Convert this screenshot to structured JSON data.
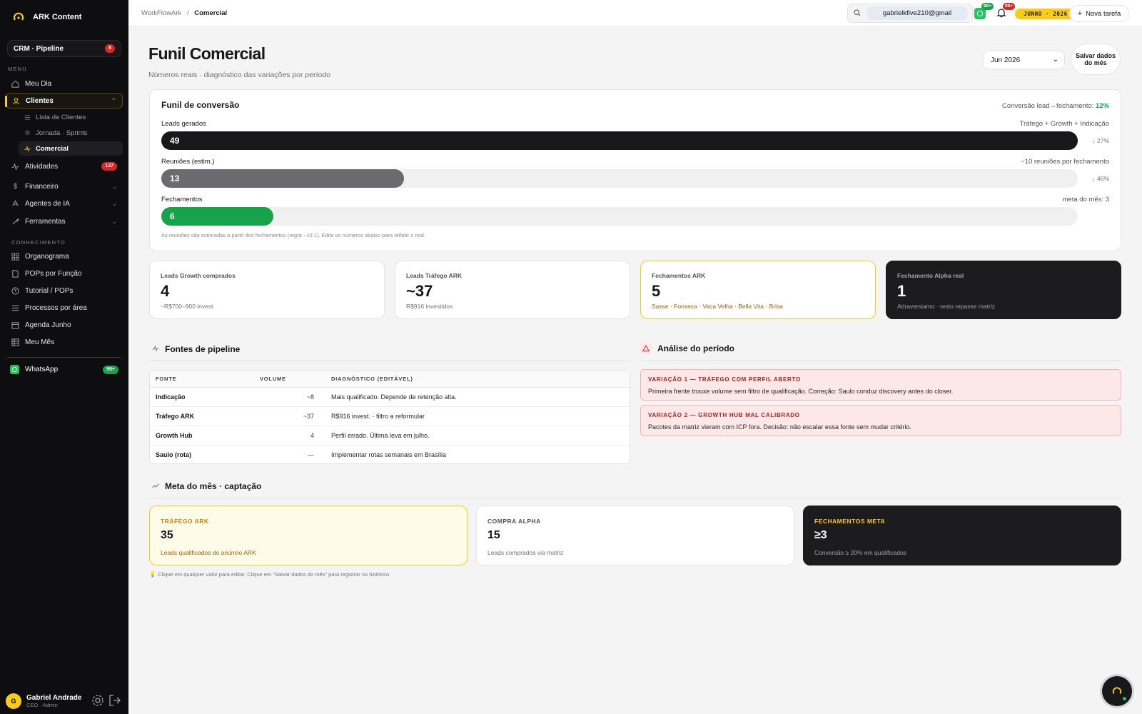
{
  "sidebar": {
    "brand": "ARK Content",
    "crm": {
      "label": "CRM · Pipeline",
      "badge": "8"
    },
    "menu_label": "MENU",
    "items": [
      {
        "label": "Meu Dia",
        "icon": "home-icon"
      },
      {
        "label": "Clientes",
        "icon": "users-icon",
        "active": true
      },
      {
        "label": "Atividades",
        "icon": "activity-icon",
        "badge": "137"
      },
      {
        "label": "Financeiro",
        "icon": "dollar-icon"
      },
      {
        "label": "Agentes de IA",
        "icon": "bot-icon"
      },
      {
        "label": "Ferramentas",
        "icon": "tools-icon"
      }
    ],
    "subitems": [
      {
        "label": "Lista de Clientes",
        "icon": "list-icon"
      },
      {
        "label": "Jornada · Sprints",
        "icon": "map-pin-icon"
      },
      {
        "label": "Comercial",
        "icon": "pulse-icon",
        "active": true
      }
    ],
    "knowledge_label": "CONHECIMENTO",
    "knowledge": [
      {
        "label": "Organograma",
        "icon": "grid-icon"
      },
      {
        "label": "POPs por Função",
        "icon": "document-icon"
      },
      {
        "label": "Tutorial / POPs",
        "icon": "help-icon"
      },
      {
        "label": "Processos por área",
        "icon": "list-icon"
      },
      {
        "label": "Agenda Junho",
        "icon": "calendar-icon"
      },
      {
        "label": "Meu Mês",
        "icon": "table-icon"
      }
    ],
    "whatsapp": {
      "label": "WhatsApp",
      "badge": "99+"
    },
    "user": {
      "initial": "G",
      "name": "Gabriel Andrade",
      "role": "CEO · Admin"
    }
  },
  "topbar": {
    "breadcrumb_root": "WorkFlowArk",
    "breadcrumb_sep": "/",
    "breadcrumb_current": "Comercial",
    "search_value": "gabrielkfive210@gmail",
    "whatsapp_badge": "99+",
    "bell_badge": "99+",
    "date_pill": "JUNHO · 2026",
    "new_task": "Nova tarefa"
  },
  "page": {
    "title": "Funil Comercial",
    "subtitle": "Números reais · diagnóstico das variações por período",
    "month_select": "Jun 2026",
    "save_button": "Salvar dados do mês"
  },
  "funnel": {
    "title": "Funil de conversão",
    "conversion_label": "Conversão lead→fechamento:",
    "conversion_value": "12%",
    "stages": [
      {
        "label": "Leads gerados",
        "right": "Tráfego + Growth + Indicação",
        "value": "49",
        "fill": 1.0,
        "color": "#18181b",
        "drop": "↓ 27%"
      },
      {
        "label": "Reuniões (estim.)",
        "right": "~10 reuniões por fechamento",
        "value": "13",
        "fill": 0.265,
        "color": "#6b6b6f",
        "drop": "↓ 46%"
      },
      {
        "label": "Fechamentos",
        "right": "meta do mês: 3",
        "value": "6",
        "fill": 0.122,
        "color": "#16a34a",
        "drop": ""
      }
    ],
    "note": "As reuniões são estimadas a partir dos fechamentos (regra ~10:1). Edite os números abaixo para refletir o real."
  },
  "stats": [
    {
      "label": "Leads Growth comprados",
      "value": "4",
      "sub": "~R$700–900 invest."
    },
    {
      "label": "Leads Tráfego ARK",
      "value": "~37",
      "sub": "R$916 investidos"
    },
    {
      "label": "Fechamentos ARK",
      "value": "5",
      "sub": "Sasse · Fonseca · Vaca Velha · Bella Vita · Brisa"
    },
    {
      "label": "Fechamento Alpha real",
      "value": "1",
      "sub": "Attraversiamo · resto repasse matriz"
    }
  ],
  "pipeline": {
    "title": "Fontes de pipeline",
    "headers": [
      "FONTE",
      "VOLUME",
      "DIAGNÓSTICO (EDITÁVEL)"
    ],
    "rows": [
      {
        "source": "Indicação",
        "volume": "~8",
        "diagnosis": "Mais qualificado. Depende de retenção alta."
      },
      {
        "source": "Tráfego ARK",
        "volume": "~37",
        "diagnosis": "R$916 invest. · filtro a reformular"
      },
      {
        "source": "Growth Hub",
        "volume": "4",
        "diagnosis": "Perfil errado. Última leva em julho."
      },
      {
        "source": "Saulo (rota)",
        "volume": "—",
        "diagnosis": "Implementar rotas semanais em Brasília"
      }
    ]
  },
  "analysis": {
    "title": "Análise do período",
    "alerts": [
      {
        "title": "VARIAÇÃO 1 — TRÁFEGO COM PERFIL ABERTO",
        "body": "Primeira frente trouxe volume sem filtro de qualificação. Correção: Saulo conduz discovery antes do closer."
      },
      {
        "title": "VARIAÇÃO 2 — GROWTH HUB MAL CALIBRADO",
        "body": "Pacotes da matriz vieram com ICP fora. Decisão: não escalar essa fonte sem mudar critério."
      }
    ]
  },
  "goals": {
    "title": "Meta do mês · captação",
    "cards": [
      {
        "label": "TRÁFEGO ARK",
        "value": "35",
        "sub": "Leads qualificados do anúncio ARK"
      },
      {
        "label": "COMPRA ALPHA",
        "value": "15",
        "sub": "Leads comprados via matriz"
      },
      {
        "label": "FECHAMENTOS META",
        "value": "≥3",
        "sub": "Conversão ≥ 20% em qualificados"
      }
    ],
    "hint": "Clique em qualquer valor para editar. Clique em \"Salvar dados do mês\" para registrar no histórico."
  },
  "colors": {
    "accent": "#facc15",
    "success": "#16a34a",
    "danger": "#dc2626",
    "sidebar": "#0e0e10"
  }
}
